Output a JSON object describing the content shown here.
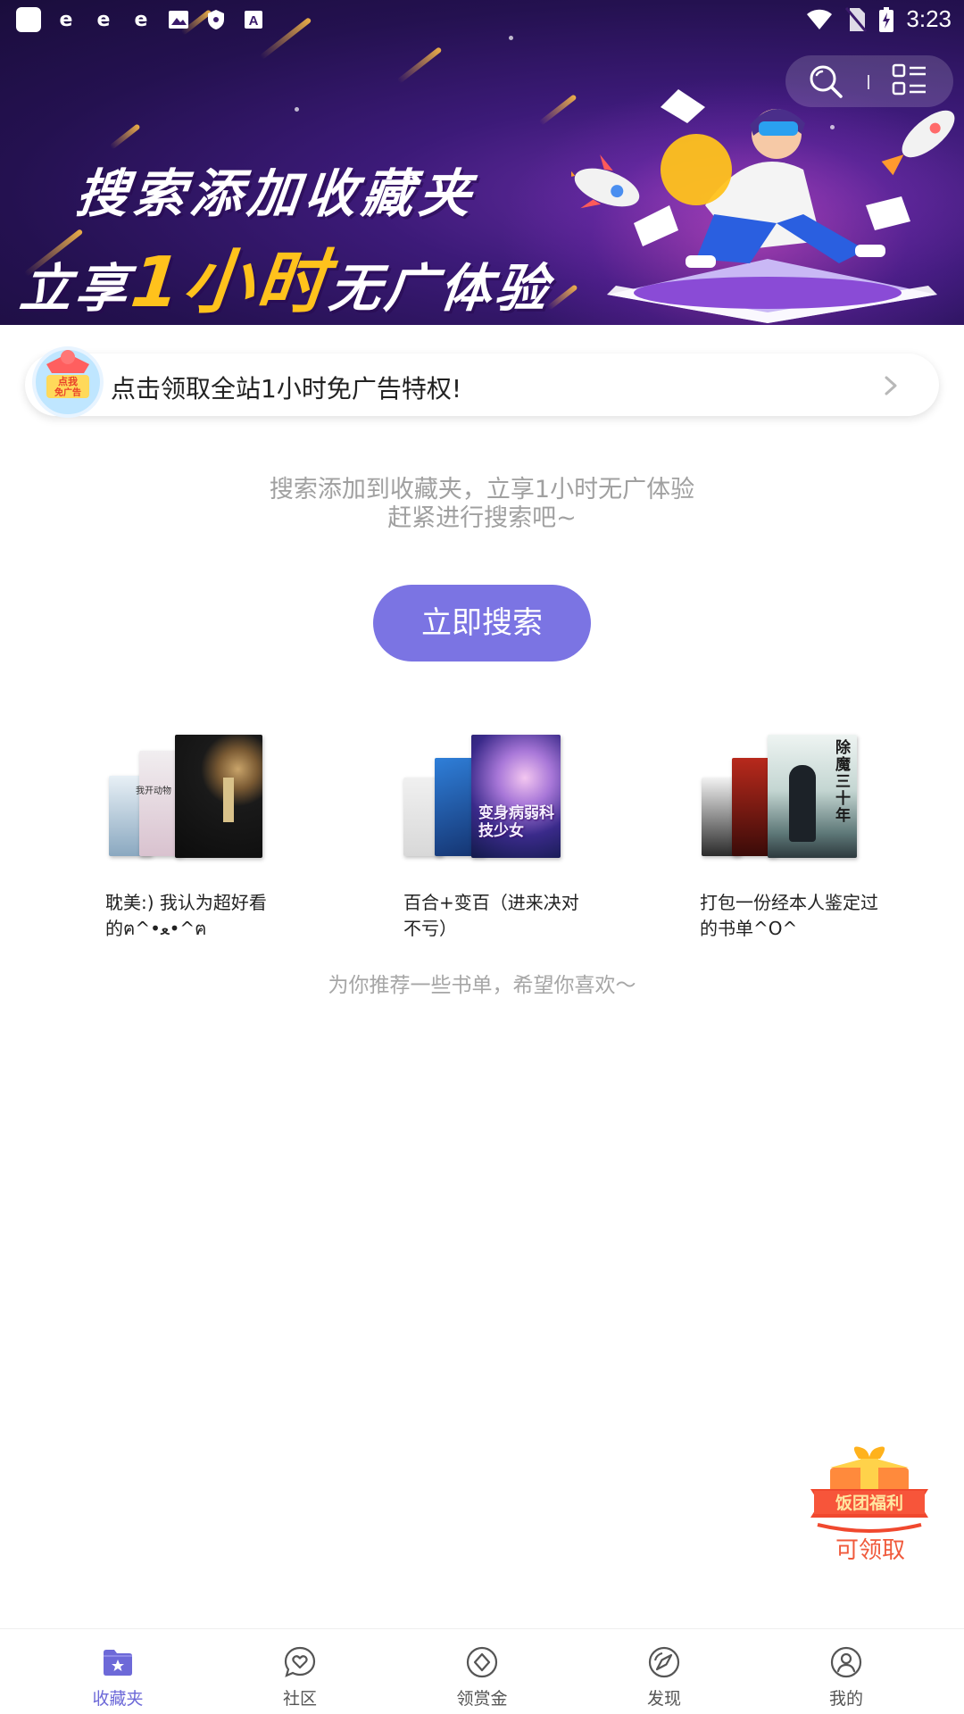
{
  "status_bar": {
    "time": "3:23",
    "left_icons": [
      "app-square-icon",
      "ie-icon",
      "ie-icon",
      "ie-icon",
      "image-icon",
      "shield-icon",
      "font-icon"
    ],
    "right_icons": [
      "wifi-icon",
      "no-sim-icon",
      "battery-charging-icon"
    ]
  },
  "banner": {
    "line1": "搜索添加收藏夹",
    "line2_prefix": "立享",
    "line2_highlight": "1小时",
    "line2_suffix": "无广体验",
    "highlight_color": "#ffc21c"
  },
  "toolbar": {
    "search_icon": "search-icon",
    "menu_icon": "list-grid-icon"
  },
  "promo": {
    "badge_text_top": "点我",
    "badge_text_bottom": "免广告",
    "text": "点击领取全站1小时免广告特权!"
  },
  "empty_state": {
    "line1": "搜索添加到收藏夹，立享1小时无广体验",
    "line2": "赶紧进行搜索吧~",
    "button_label": "立即搜索",
    "button_color": "#7b74e3"
  },
  "booklists": [
    {
      "caption": "耽美:) 我认为超好看的ฅ^•ﻌ•^ฅ",
      "cover_main_text": "我开动物"
    },
    {
      "caption": "百合+变百（进来决对不亏）",
      "cover_main_text": "变身病弱科技少女"
    },
    {
      "caption": "打包一份经本人鉴定过的书单^O^",
      "cover_main_text": "除魔三十年"
    }
  ],
  "recommend_text": "为你推荐一些书单，希望你喜欢～",
  "gift": {
    "banner_text": "饭团福利",
    "label": "可领取"
  },
  "bottom_nav": [
    {
      "label": "收藏夹",
      "icon": "favorites-folder-icon",
      "active": true
    },
    {
      "label": "社区",
      "icon": "heart-chat-icon",
      "active": false
    },
    {
      "label": "领赏金",
      "icon": "diamond-coin-icon",
      "active": false
    },
    {
      "label": "发现",
      "icon": "compass-icon",
      "active": false
    },
    {
      "label": "我的",
      "icon": "user-profile-icon",
      "active": false
    }
  ],
  "colors": {
    "accent": "#6d69d8",
    "banner_bg": "#2a1458",
    "gift_red": "#f05a3c"
  }
}
